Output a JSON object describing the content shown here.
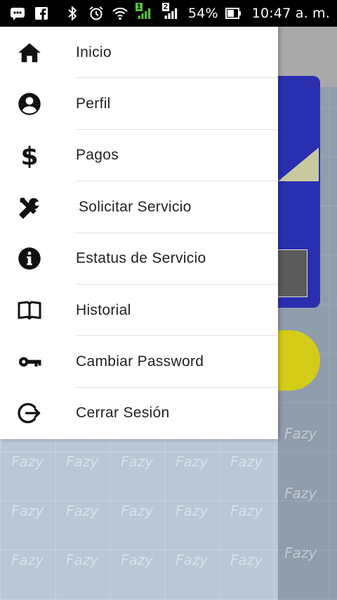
{
  "status_bar": {
    "battery_percent": "54%",
    "time": "10:47 a. m.",
    "sim1_label": "1",
    "sim2_label": "2",
    "icons": [
      "messages-icon",
      "facebook-icon",
      "bluetooth-icon",
      "alarm-icon",
      "wifi-icon",
      "signal-sim1-icon",
      "signal-sim2-icon",
      "battery-icon"
    ]
  },
  "drawer": {
    "items": [
      {
        "label": "Inicio",
        "icon": "home-icon"
      },
      {
        "label": "Perfil",
        "icon": "account-circle-icon"
      },
      {
        "label": "Pagos",
        "icon": "dollar-icon"
      },
      {
        "label": "Solicitar Servicio",
        "icon": "tools-icon"
      },
      {
        "label": "Estatus de Servicio",
        "icon": "info-icon"
      },
      {
        "label": "Historial",
        "icon": "book-icon"
      },
      {
        "label": "Cambiar Password",
        "icon": "key-icon"
      },
      {
        "label": "Cerrar Sesión",
        "icon": "logout-icon"
      }
    ]
  },
  "background": {
    "watermark_text": "Fazy"
  }
}
